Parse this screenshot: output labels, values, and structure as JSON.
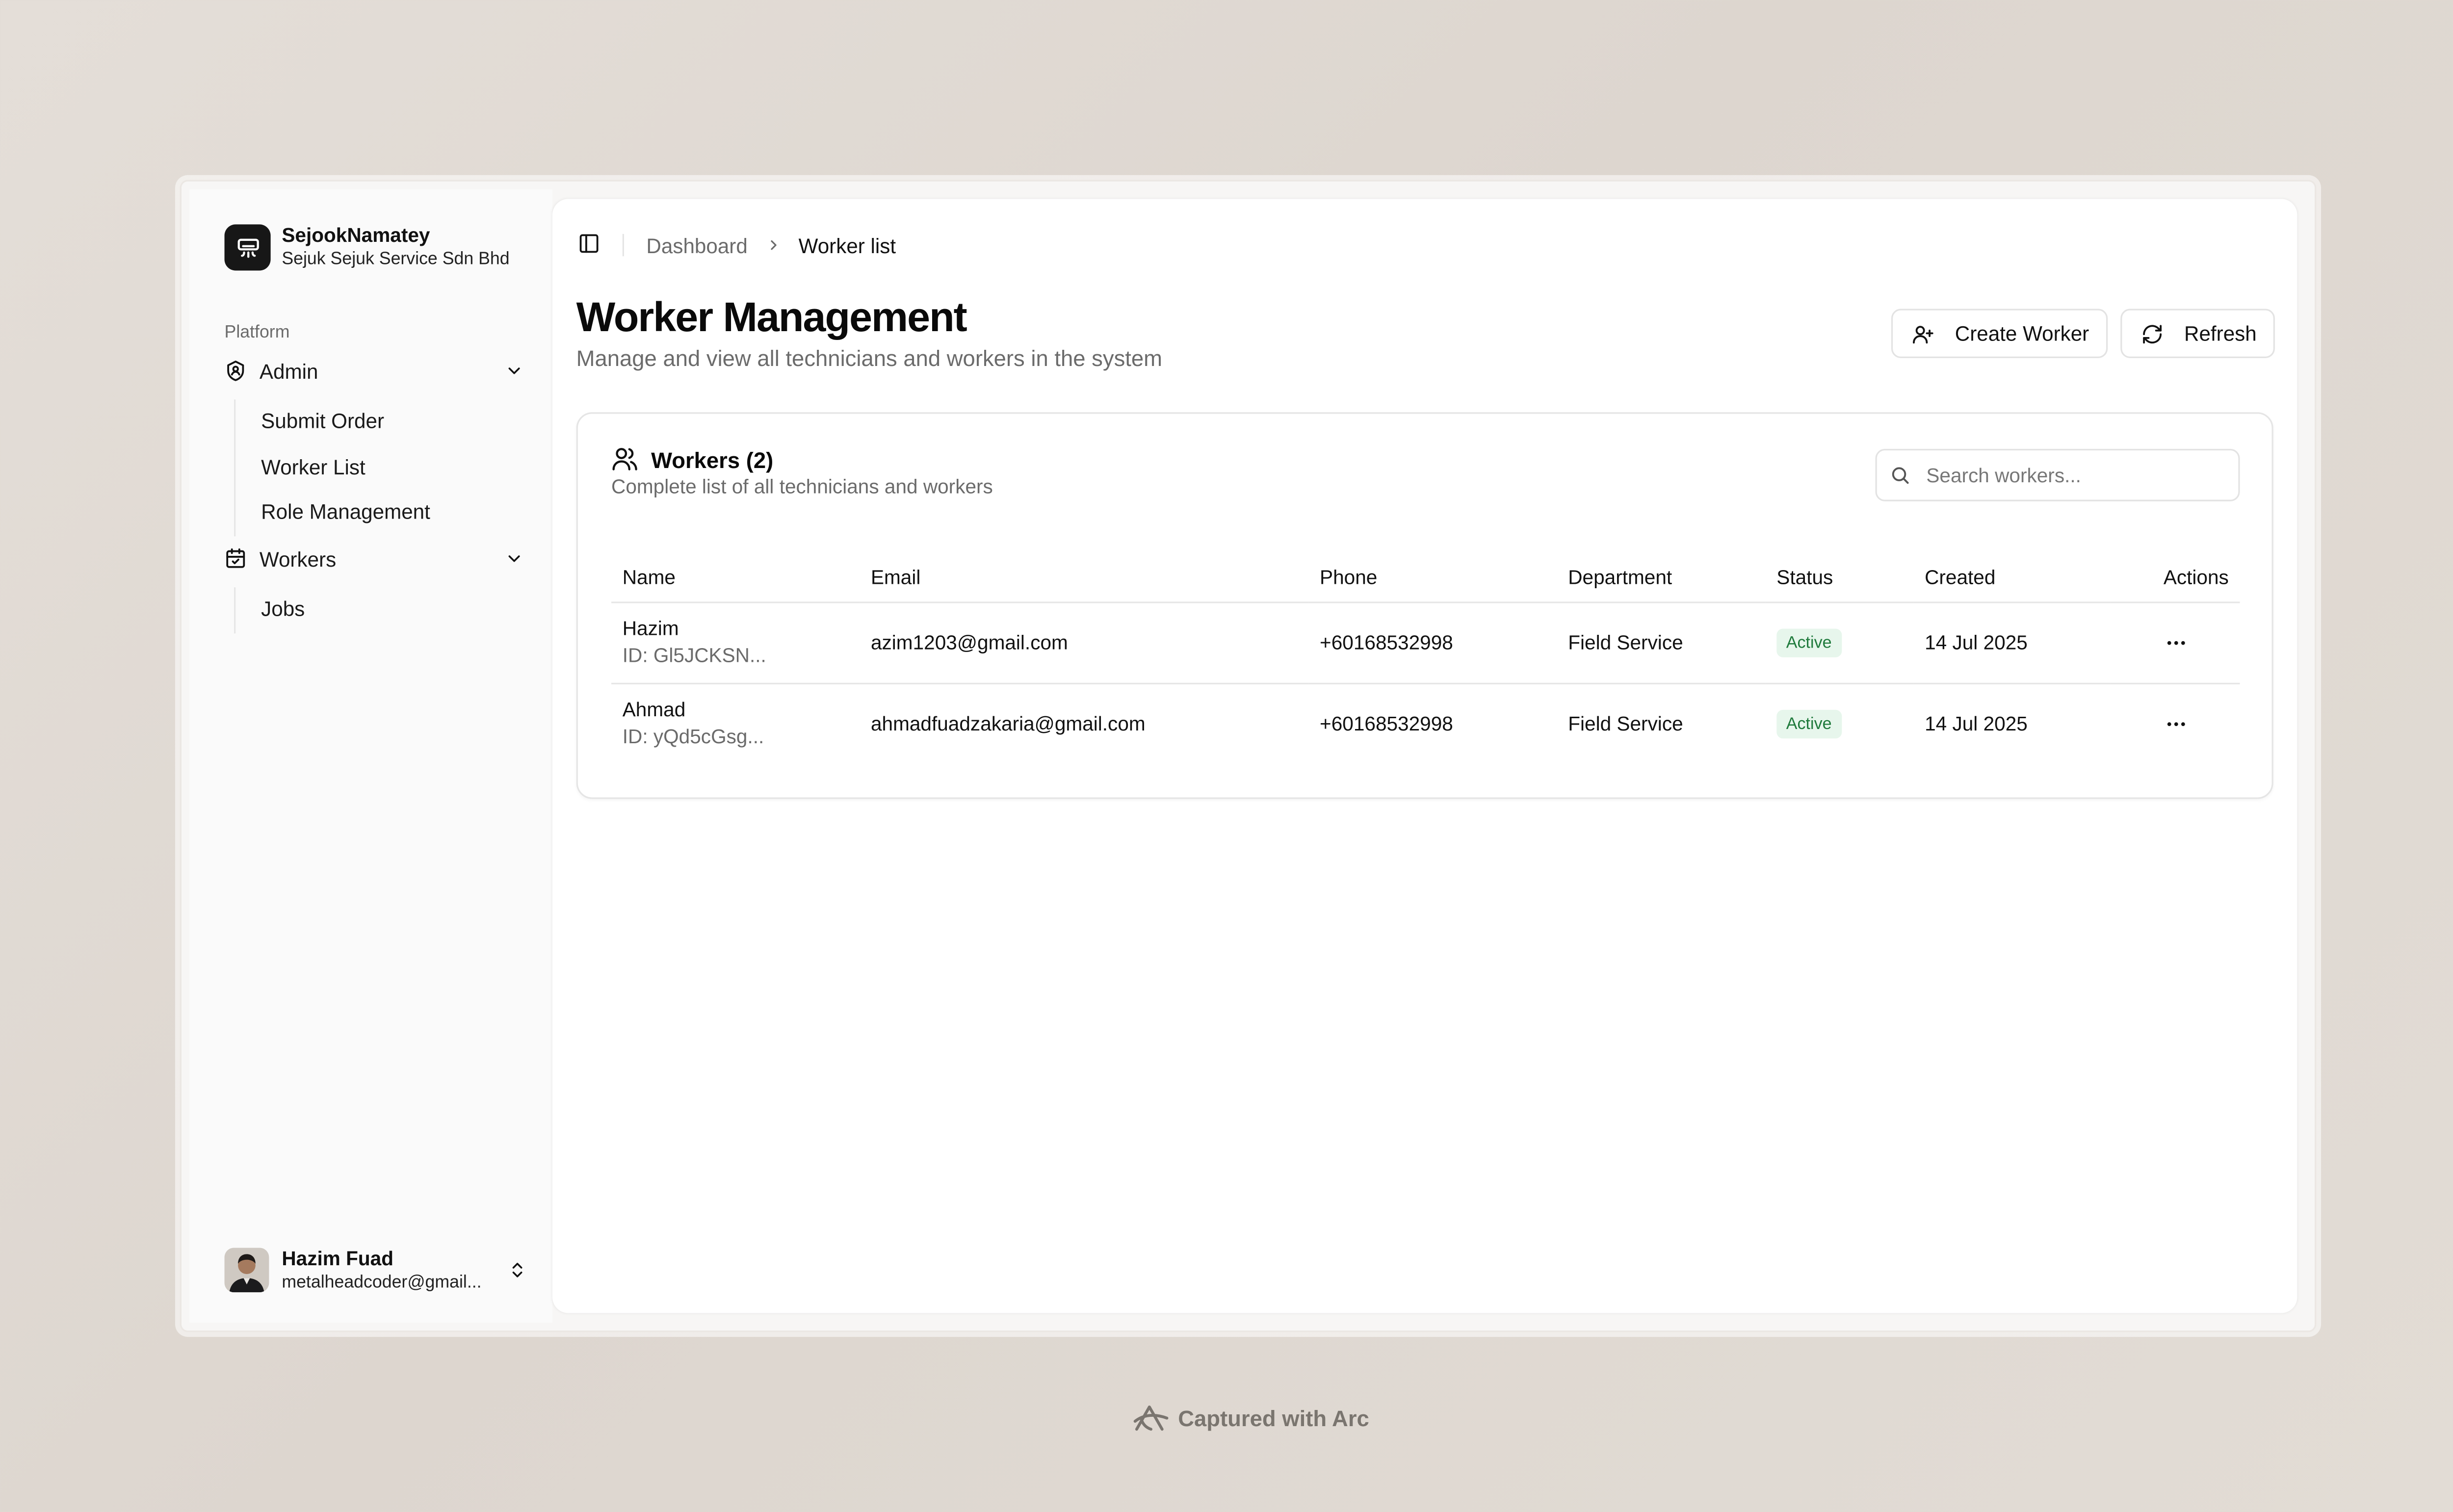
{
  "brand": {
    "name": "SejookNamatey",
    "subtitle": "Sejuk Sejuk Service Sdn Bhd",
    "logo_icon": "air-conditioner-icon"
  },
  "sidebar": {
    "group_label": "Platform",
    "sections": [
      {
        "label": "Admin",
        "icon": "shield-user-icon",
        "items": [
          {
            "label": "Submit Order"
          },
          {
            "label": "Worker List"
          },
          {
            "label": "Role Management"
          }
        ]
      },
      {
        "label": "Workers",
        "icon": "calendar-check-icon",
        "items": [
          {
            "label": "Jobs"
          }
        ]
      }
    ]
  },
  "user": {
    "name": "Hazim Fuad",
    "email": "metalheadcoder@gmail..."
  },
  "breadcrumb": {
    "parent": "Dashboard",
    "current": "Worker list"
  },
  "page": {
    "title": "Worker Management",
    "subtitle": "Manage and view all technicians and workers in the system",
    "create_label": "Create Worker",
    "refresh_label": "Refresh"
  },
  "card": {
    "title": "Workers (2)",
    "subtitle": "Complete list of all technicians and workers",
    "search_placeholder": "Search workers..."
  },
  "table": {
    "columns": [
      "Name",
      "Email",
      "Phone",
      "Department",
      "Status",
      "Created",
      "Actions"
    ],
    "rows": [
      {
        "name": "Hazim",
        "id": "ID: Gl5JCKSN...",
        "email": "azim1203@gmail.com",
        "phone": "+60168532998",
        "department": "Field Service",
        "status": "Active",
        "created": "14 Jul 2025"
      },
      {
        "name": "Ahmad",
        "id": "ID: yQd5cGsg...",
        "email": "ahmadfuadzakaria@gmail.com",
        "phone": "+60168532998",
        "department": "Field Service",
        "status": "Active",
        "created": "14 Jul 2025"
      }
    ]
  },
  "footer": {
    "capture_text": "Captured with Arc"
  },
  "colors": {
    "accent": "#171717",
    "status_active_bg": "#e7f6ec",
    "status_active_text": "#1f7a3c",
    "muted_text": "#6b6b6b"
  }
}
